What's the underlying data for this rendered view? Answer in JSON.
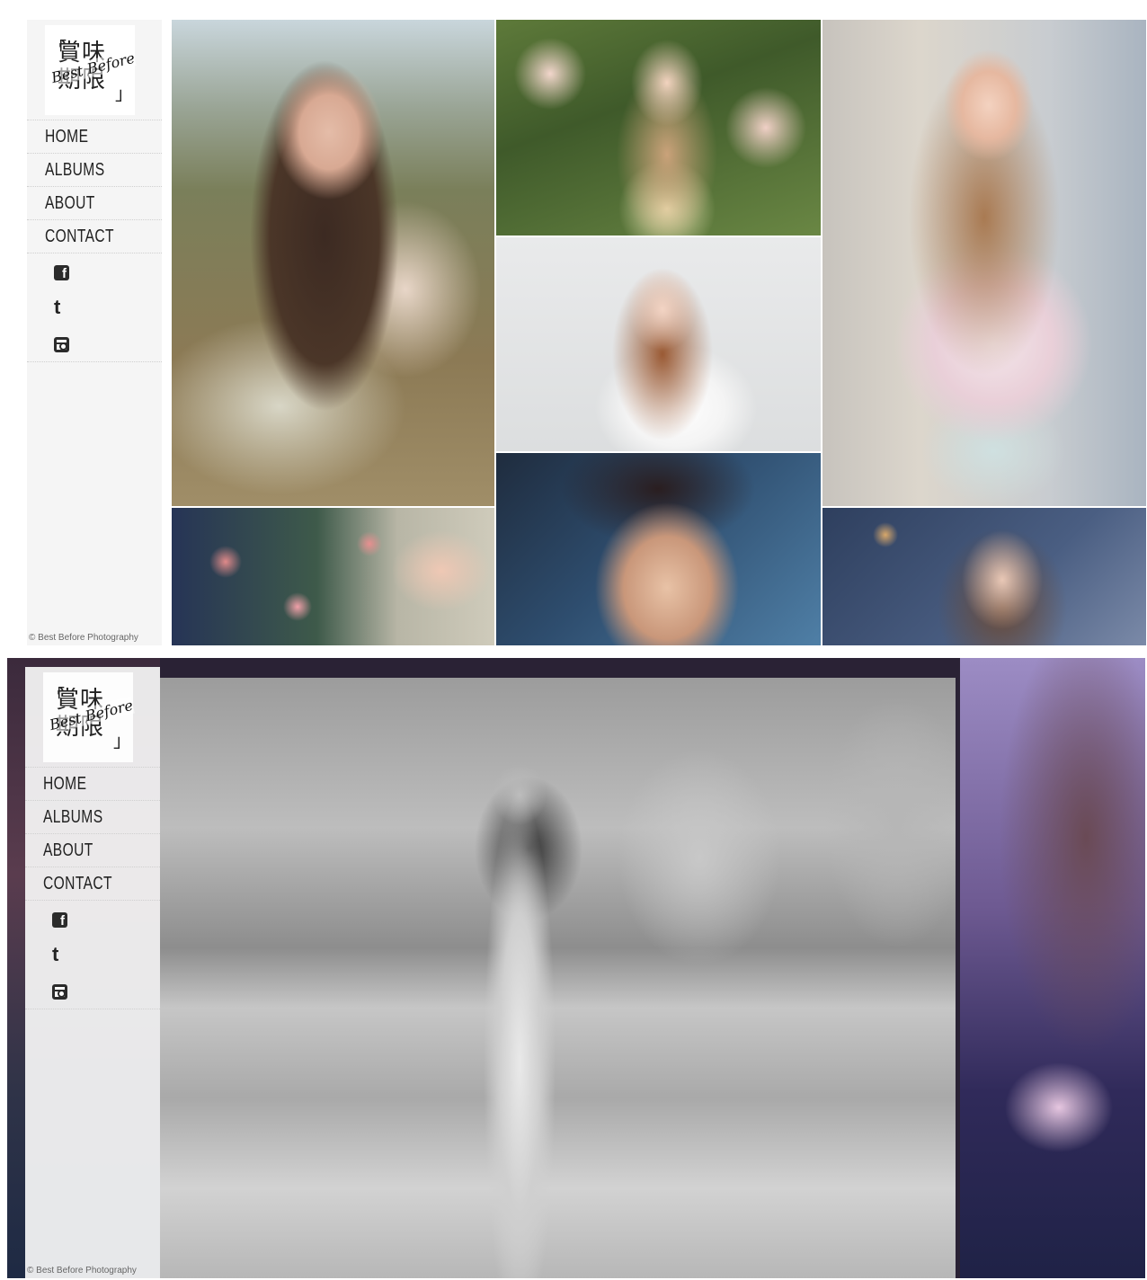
{
  "brand": {
    "logo_jp_top": "賞味",
    "logo_jp_bottom": "期限",
    "logo_bracket_open": "「",
    "logo_bracket_close": "」",
    "logo_en": "Best Before"
  },
  "nav": {
    "items": [
      {
        "label": "HOME"
      },
      {
        "label": "ALBUMS"
      },
      {
        "label": "ABOUT"
      },
      {
        "label": "CONTACT"
      }
    ]
  },
  "social": {
    "facebook_glyph": "f",
    "tumblr_glyph": "t",
    "icons": [
      "facebook-icon",
      "tumblr-icon",
      "instagram-icon"
    ]
  },
  "footer": {
    "copyright": "© Best Before Photography"
  },
  "colors": {
    "sidebar_bg": "#f5f5f5",
    "nav_text": "#222222",
    "divider": "#cfcfcf"
  }
}
